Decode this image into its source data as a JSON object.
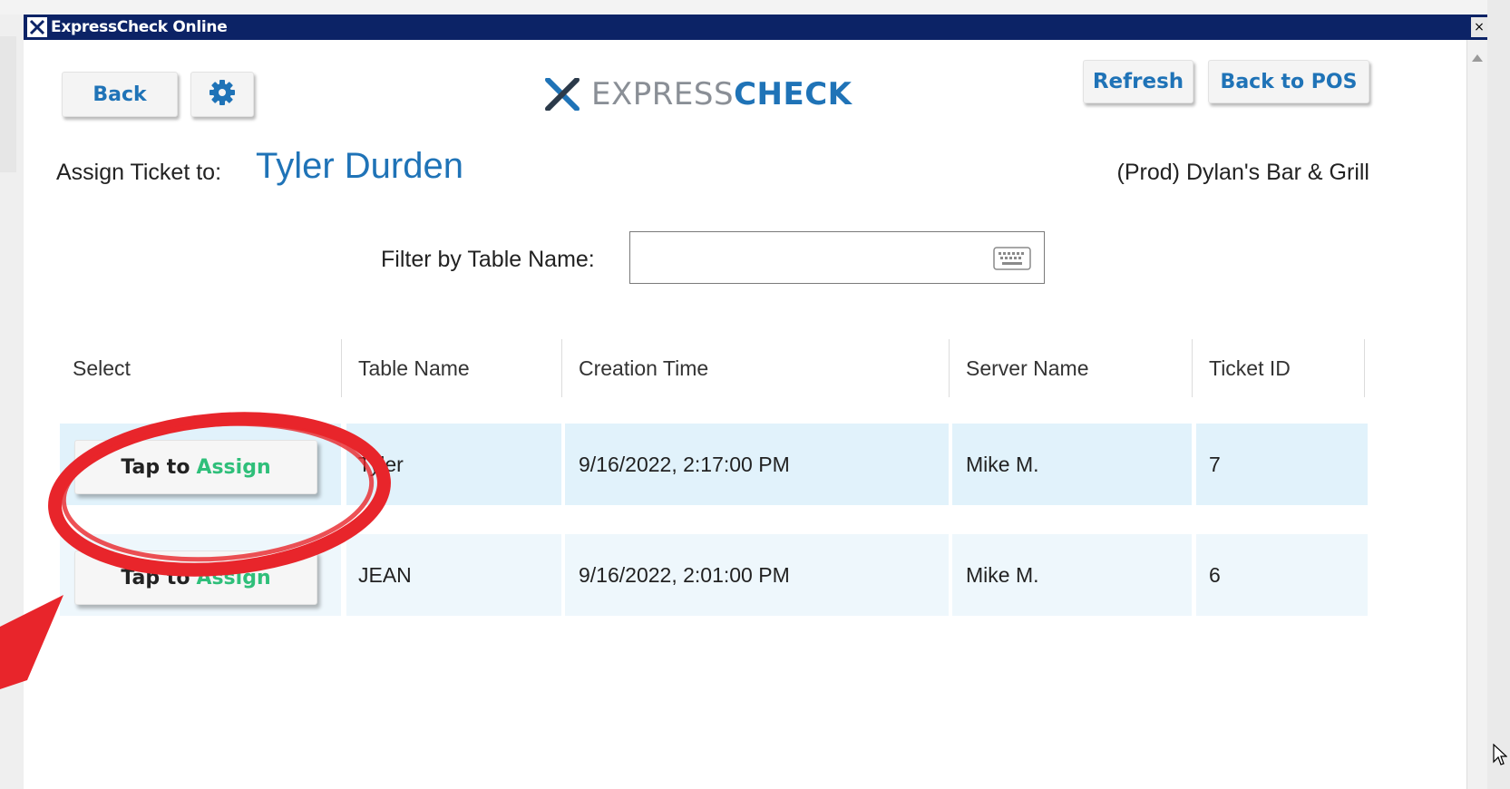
{
  "window": {
    "title": "ExpressCheck Online",
    "close_glyph": "×"
  },
  "toolbar": {
    "back_label": "Back",
    "refresh_label": "Refresh",
    "back_to_pos_label": "Back to POS"
  },
  "logo": {
    "light": "EXPRESS",
    "bold": "CHECK"
  },
  "assign": {
    "label": "Assign Ticket to:",
    "name": "Tyler Durden",
    "venue": "(Prod) Dylan's Bar & Grill"
  },
  "filter": {
    "label": "Filter by Table Name:",
    "value": ""
  },
  "table": {
    "headers": [
      "Select",
      "Table Name",
      "Creation Time",
      "Server Name",
      "Ticket ID"
    ],
    "rows": [
      {
        "button_tap": "Tap to",
        "button_assign": "Assign",
        "table_name": "Tyler",
        "creation_time": "9/16/2022, 2:17:00 PM",
        "server_name": "Mike M.",
        "ticket_id": "7"
      },
      {
        "button_tap": "Tap to",
        "button_assign": "Assign",
        "table_name": "JEAN",
        "creation_time": "9/16/2022, 2:01:00 PM",
        "server_name": "Mike M.",
        "ticket_id": "6"
      }
    ]
  },
  "colors": {
    "titlebar": "#0c2366",
    "brand_blue": "#1f73b7",
    "assign_green": "#2fbf7a",
    "annotation_red": "#e8252b"
  },
  "icons": {
    "gear": "gear-icon",
    "keyboard": "keyboard-icon",
    "app": "expresscheck-x-icon"
  }
}
